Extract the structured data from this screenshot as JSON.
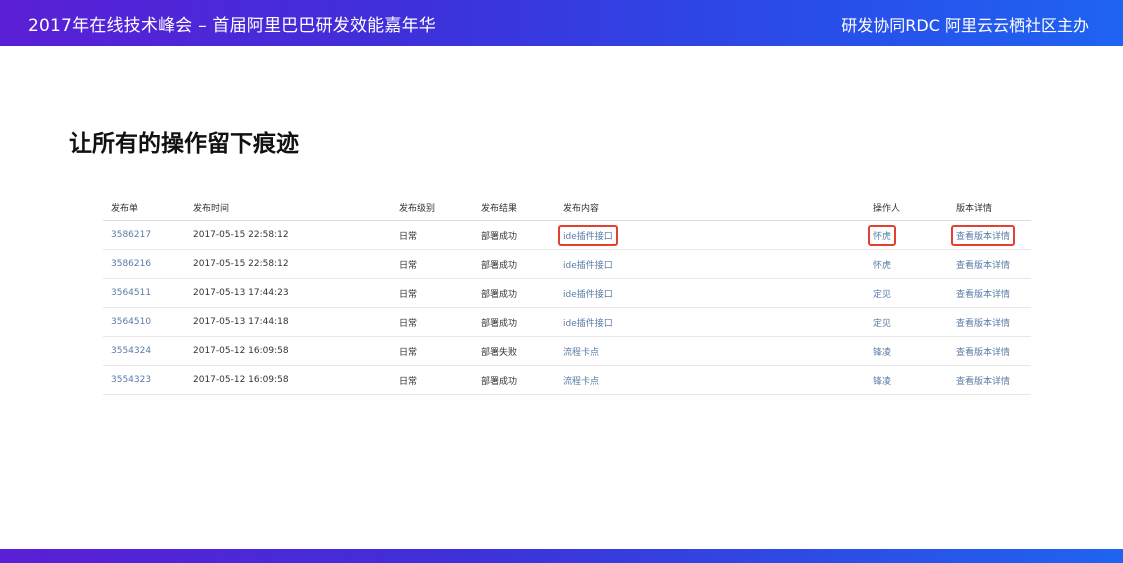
{
  "banner": {
    "left": "2017年在线技术峰会 – 首届阿里巴巴研发效能嘉年华",
    "right": "研发协同RDC 阿里云云栖社区主办"
  },
  "slide": {
    "title": "让所有的操作留下痕迹"
  },
  "table": {
    "headers": [
      "发布单",
      "发布时间",
      "发布级别",
      "发布结果",
      "发布内容",
      "操作人",
      "版本详情"
    ],
    "rows": [
      {
        "id": "3586217",
        "time": "2017-05-15 22:58:12",
        "level": "日常",
        "result": "部署成功",
        "content": "ide插件接口",
        "operator": "怀虎",
        "detail": "查看版本详情"
      },
      {
        "id": "3586216",
        "time": "2017-05-15 22:58:12",
        "level": "日常",
        "result": "部署成功",
        "content": "ide插件接口",
        "operator": "怀虎",
        "detail": "查看版本详情"
      },
      {
        "id": "3564511",
        "time": "2017-05-13 17:44:23",
        "level": "日常",
        "result": "部署成功",
        "content": "ide插件接口",
        "operator": "定见",
        "detail": "查看版本详情"
      },
      {
        "id": "3564510",
        "time": "2017-05-13 17:44:18",
        "level": "日常",
        "result": "部署成功",
        "content": "ide插件接口",
        "operator": "定见",
        "detail": "查看版本详情"
      },
      {
        "id": "3554324",
        "time": "2017-05-12 16:09:58",
        "level": "日常",
        "result": "部署失败",
        "content": "流程卡点",
        "operator": "锋凌",
        "detail": "查看版本详情"
      },
      {
        "id": "3554323",
        "time": "2017-05-12 16:09:58",
        "level": "日常",
        "result": "部署成功",
        "content": "流程卡点",
        "operator": "锋凌",
        "detail": "查看版本详情"
      }
    ]
  },
  "colors": {
    "link": "#5a7ba6",
    "highlight": "#e2412f",
    "banner_start": "#5b1fd6",
    "banner_end": "#1f63f2"
  }
}
